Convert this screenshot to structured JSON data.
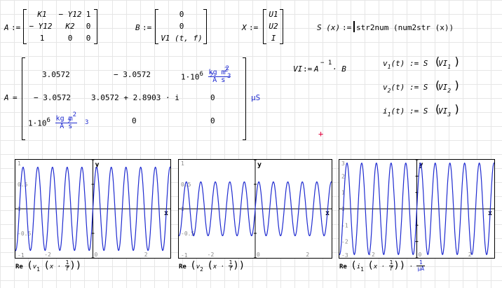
{
  "defs": {
    "A_name": "A",
    "assign": ":=",
    "A_matrix": [
      [
        "K1",
        "− Y12",
        "1"
      ],
      [
        "− Y12",
        "K2",
        "0"
      ],
      [
        "1",
        "0",
        "0"
      ]
    ],
    "B_name": "B",
    "B_vector": [
      "0",
      "0",
      "V1 (t, f)"
    ],
    "X_name": "X",
    "X_vector": [
      "U1",
      "U2",
      "I"
    ],
    "S_lhs": "S (x)",
    "S_rhs": "str2num (num2str (x))"
  },
  "result": {
    "A_name": "A",
    "equals": "=",
    "unit": "μS",
    "row1": [
      "3.0572",
      "− 3.0572",
      "1·10"
    ],
    "row2": [
      "− 3.0572",
      "3.0572 + 2.8903 · i",
      "0"
    ],
    "row3": [
      "1·10",
      "0",
      "0"
    ],
    "exp6": "6",
    "kgm2_num": "kg m",
    "kgm2_den": "A  s",
    "sq": "2",
    "cube": "3"
  },
  "solve": {
    "lhs": "VI",
    "rhs": "A",
    "inv": "− 1",
    "times_B": "· B",
    "v1_lhs": "v",
    "v1_sub": "1",
    "v1_arg": "(t) := S",
    "v1_rhs": "VI",
    "v1_idx": "1",
    "v2_lhs": "v",
    "v2_sub": "2",
    "v2_arg": "(t) := S",
    "v2_rhs": "VI",
    "v2_idx": "2",
    "i1_lhs": "i",
    "i1_sub": "1",
    "i1_arg": "(t) := S",
    "i1_rhs": "VI",
    "i1_idx": "3"
  },
  "plots": [
    {
      "ylabel": "y",
      "xlabel": "x",
      "ymin": -1,
      "ymax": 1,
      "xmin": -3.1,
      "xmax": 3.1,
      "yticks": [
        "1",
        "0.5",
        "0",
        "-0.5",
        "-1"
      ],
      "xticks": [
        "-2",
        "0",
        "2"
      ],
      "trace_fn": "Re",
      "trace_var": "v",
      "trace_sub": "1",
      "trace_arg": "x ·",
      "frac_num": "1",
      "frac_den": "f",
      "trace_unit": "",
      "amplitude": 0.85,
      "frequency": 1.7,
      "color": "#1f2bd0"
    },
    {
      "ylabel": "y",
      "xlabel": "x",
      "ymin": -1,
      "ymax": 1,
      "xmin": -3.1,
      "xmax": 3.1,
      "yticks": [
        "1",
        "0.5",
        "0",
        "-0.5",
        "-1"
      ],
      "xticks": [
        "-2",
        "0",
        "2"
      ],
      "trace_fn": "Re",
      "trace_var": "v",
      "trace_sub": "2",
      "trace_arg": "x ·",
      "frac_num": "1",
      "frac_den": "f",
      "trace_unit": "",
      "amplitude": 0.55,
      "frequency": 1.7,
      "color": "#1f2bd0"
    },
    {
      "ylabel": "y",
      "xlabel": "x",
      "ymin": -3,
      "ymax": 3,
      "xmin": -3.1,
      "xmax": 3.1,
      "yticks": [
        "3",
        "2",
        "1",
        "0",
        "-1",
        "-2",
        "-3"
      ],
      "xticks": [
        "-2",
        "0",
        "2"
      ],
      "trace_fn": "Re",
      "trace_var": "i",
      "trace_sub": "1",
      "trace_arg": "x ·",
      "frac_num": "1",
      "frac_den": "f",
      "trace_unit": "μA",
      "amplitude": 2.8,
      "frequency": 1.7,
      "color": "#1f2bd0"
    }
  ]
}
